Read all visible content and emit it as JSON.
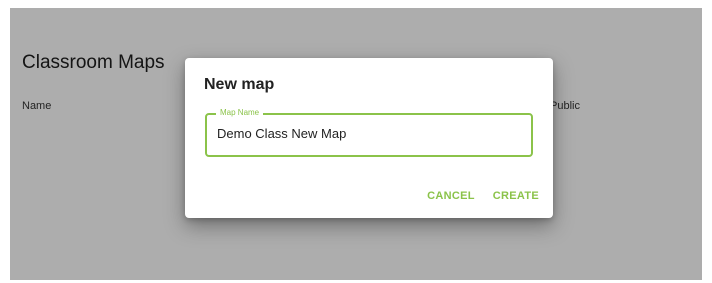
{
  "background": {
    "title": "Classroom Maps",
    "columns": {
      "name": "Name",
      "public": "Public"
    }
  },
  "dialog": {
    "title": "New map",
    "field": {
      "label": "Map Name",
      "value": "Demo Class New Map"
    },
    "actions": {
      "cancel": "CANCEL",
      "create": "CREATE"
    }
  },
  "colors": {
    "accent": "#8bc34a",
    "scrim": "rgba(0,0,0,0.32)"
  }
}
